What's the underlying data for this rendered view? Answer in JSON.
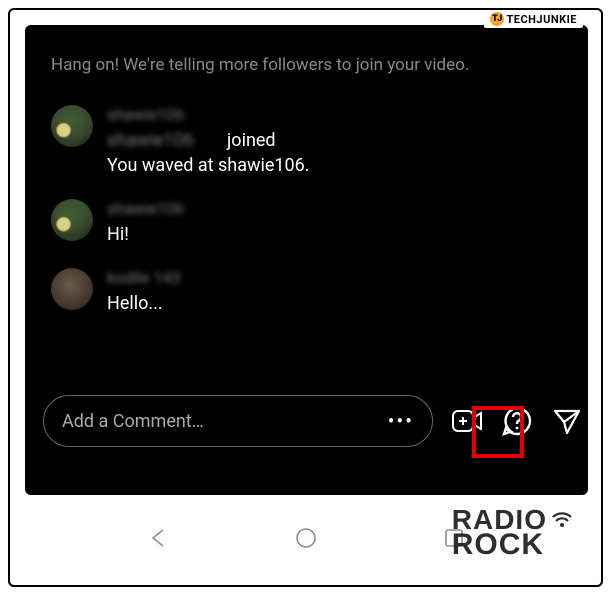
{
  "badge": {
    "label": "TECHJUNKIE",
    "icon_letter": "TJ"
  },
  "status_message": "Hang on! We're telling more followers to join your video.",
  "feed": [
    {
      "username": "shawie106",
      "lines": [
        "joined",
        "You waved at shawie106."
      ]
    },
    {
      "username": "shawie106",
      "lines": [
        "Hi!"
      ]
    },
    {
      "username": "kodile 143",
      "lines": [
        "Hello..."
      ]
    }
  ],
  "comment_input": {
    "placeholder": "Add a Comment…",
    "more_label": "•••"
  },
  "actions": {
    "add_video_label": "add-video",
    "question_label": "questions",
    "send_label": "send"
  },
  "watermark": {
    "line1": "RADIO",
    "line2": "ROCK"
  },
  "nav": {
    "back": "back",
    "home": "home",
    "recent": "recent"
  }
}
